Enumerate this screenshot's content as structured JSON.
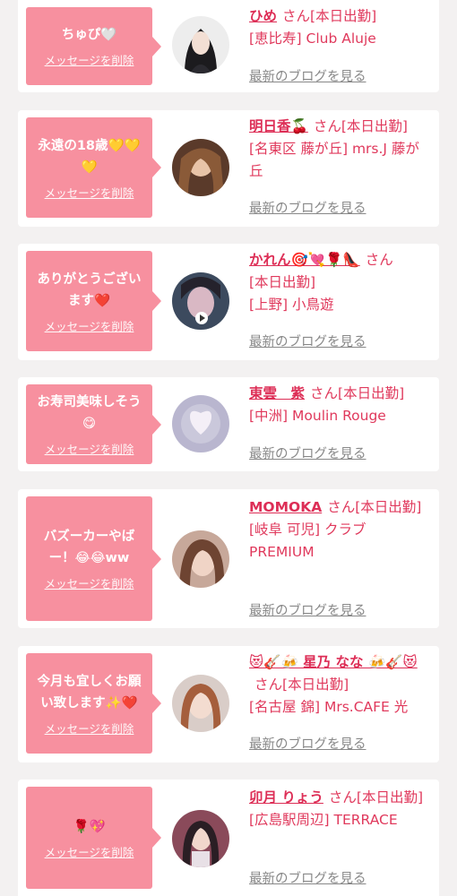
{
  "delete_label": "メッセージを削除",
  "blog_label": "最新のブログを見る",
  "san_suffix": "さん",
  "colors": {
    "bubble": "#f7909f",
    "name": "#dd2e56",
    "text": "#e0395c",
    "link_gray": "#888888",
    "background": "#f3f1f1"
  },
  "cards": [
    {
      "message": "ちゅぴ🤍",
      "name": "ひめ",
      "status": "[本日出勤]",
      "shop": "[恵比寿] Club Aluje",
      "avatar_icon": "profile-photo-icon"
    },
    {
      "message": "永遠の18歳💛💛💛",
      "name": "明日香🍒",
      "status": "[本日出勤]",
      "shop": "[名東区 藤が丘] mrs.J 藤が丘",
      "avatar_icon": "profile-photo-icon"
    },
    {
      "message": "ありがとうございます❤️",
      "name": "かれん🎯💘🌹👠",
      "status": "[本日出勤]",
      "shop": "[上野] 小鳥遊",
      "avatar_icon": "profile-video-icon"
    },
    {
      "message": "お寿司美味しそう😋",
      "name": "東雲　紫",
      "status": "[本日出勤]",
      "shop": "[中洲] Moulin Rouge",
      "avatar_icon": "profile-photo-icon"
    },
    {
      "message": "バズーカーやばー！😂😂ww",
      "name": "MOMOKA",
      "status": "[本日出勤]",
      "shop": "[岐阜 可児] クラブPREMIUM",
      "avatar_icon": "profile-photo-icon"
    },
    {
      "message": "今月も宜しくお願い致します✨❤️",
      "name": "😻🎸🍻 星乃 なな 🍻🎸😻",
      "status": "[本日出勤]",
      "shop": "[名古屋 錦] Mrs.CAFE 光",
      "avatar_icon": "profile-photo-icon"
    },
    {
      "message": "🌹💖",
      "name": "卯月 りょう",
      "status": "[本日出勤]",
      "shop": "[広島駅周辺] TERRACE",
      "avatar_icon": "profile-photo-icon"
    }
  ]
}
